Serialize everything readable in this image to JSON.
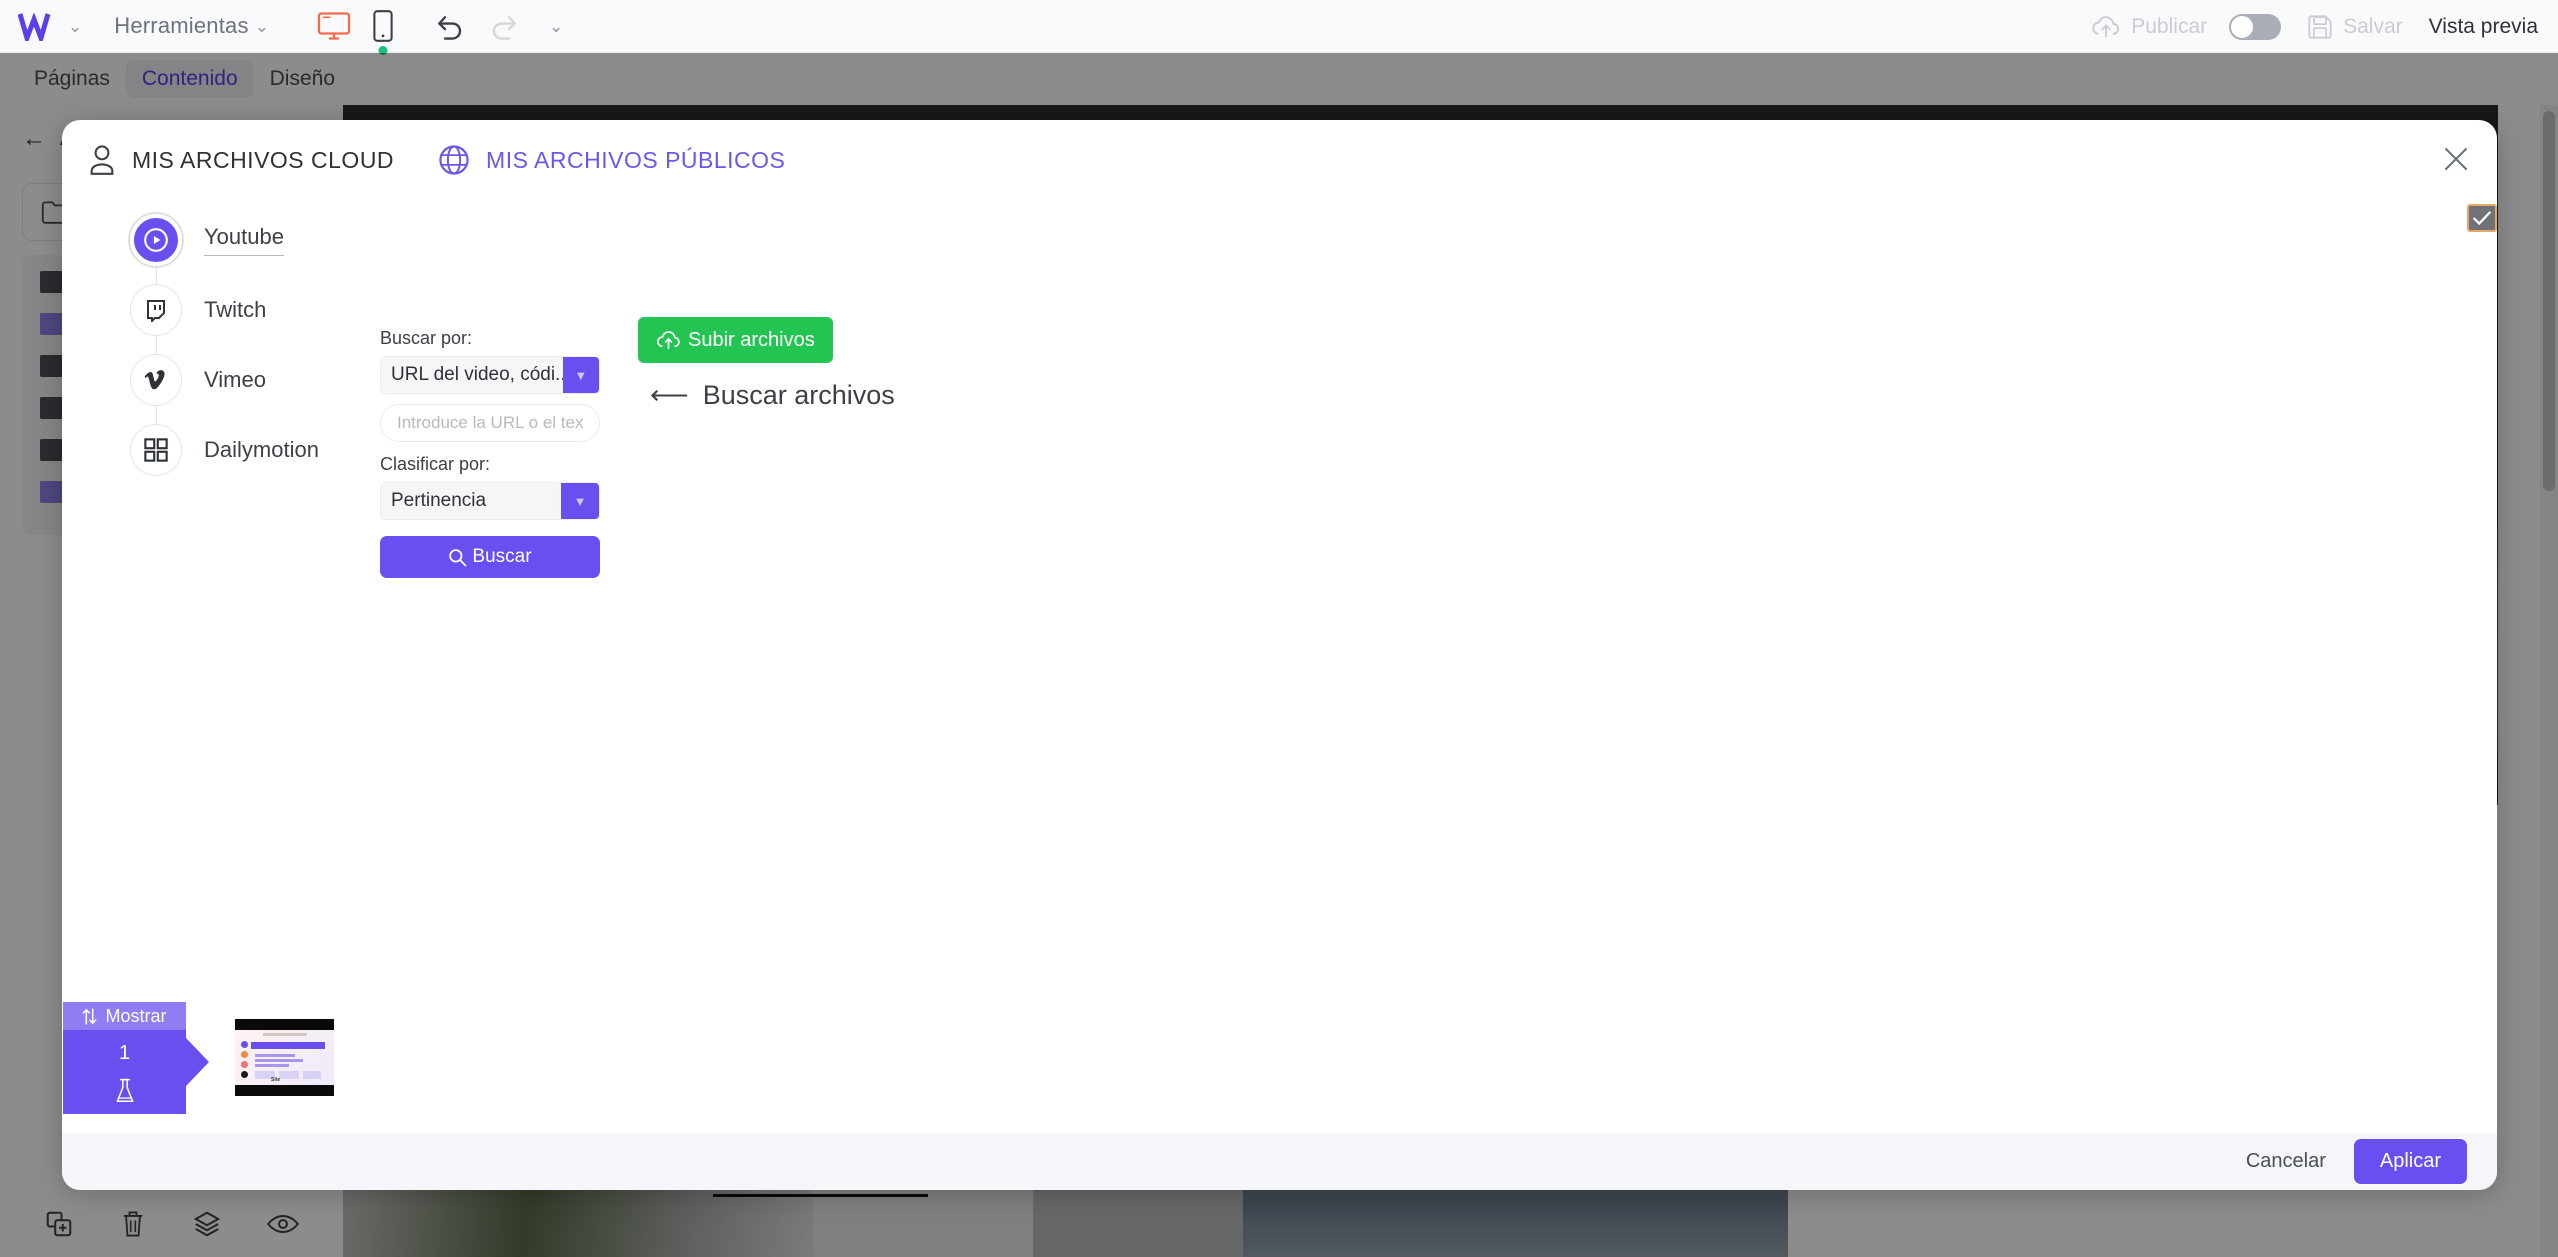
{
  "topbar": {
    "logo": "w-logo",
    "tools_label": "Herramientas",
    "publish_label": "Publicar",
    "save_label": "Salvar",
    "preview_label": "Vista previa",
    "desktop_icon": "desktop-icon",
    "mobile_icon": "mobile-icon",
    "undo_icon": "undo-icon",
    "redo_icon": "redo-icon",
    "more_icon": "chevron-down-icon"
  },
  "tabsbar": {
    "tabs": [
      {
        "label": "Páginas",
        "active": false
      },
      {
        "label": "Contenido",
        "active": true
      },
      {
        "label": "Diseño",
        "active": false
      }
    ]
  },
  "left_panel": {
    "back_label": "Atrás",
    "folder_icon": "folder-icon"
  },
  "bottom_toolbar": {
    "items": [
      {
        "icon": "duplicate-icon"
      },
      {
        "icon": "trash-icon"
      },
      {
        "icon": "layers-icon"
      },
      {
        "icon": "eye-icon"
      }
    ]
  },
  "canvas": {
    "watermark": "Site",
    "watermark_accent": "W"
  },
  "modal": {
    "tabs": [
      {
        "label": "MIS ARCHIVOS CLOUD",
        "icon": "user-icon",
        "active": true
      },
      {
        "label": "MIS ARCHIVOS PÚBLICOS",
        "icon": "globe-icon",
        "active": false
      }
    ],
    "close_icon": "close-icon",
    "selection_checkbox": {
      "icon": "check-icon",
      "checked": true
    },
    "platforms": [
      {
        "label": "Youtube",
        "icon": "youtube-icon",
        "active": true
      },
      {
        "label": "Twitch",
        "icon": "twitch-icon",
        "active": false
      },
      {
        "label": "Vimeo",
        "icon": "vimeo-icon",
        "active": false
      },
      {
        "label": "Dailymotion",
        "icon": "dailymotion-icon",
        "active": false
      }
    ],
    "form": {
      "search_by_label": "Buscar por:",
      "search_by_value": "URL del video, códi...",
      "query_placeholder": "Introduce la URL o el texto",
      "query_value": "",
      "sort_by_label": "Clasificar por:",
      "sort_by_value": "Pertinencia",
      "search_button_label": "Buscar",
      "search_button_icon": "magnifier-icon"
    },
    "content": {
      "upload_button_label": "Subir archivos",
      "upload_button_icon": "cloud-upload-icon",
      "back_link_label": "Buscar archivos",
      "back_link_icon": "arrow-left-icon"
    },
    "footer": {
      "cancel_label": "Cancelar",
      "apply_label": "Aplicar"
    }
  },
  "mostrar_widget": {
    "header_label": "Mostrar",
    "header_icon": "sort-arrows-icon",
    "count": "1",
    "bottom_icon": "flask-icon"
  },
  "colors": {
    "accent_purple": "#6a4ff0",
    "accent_purple_light": "#8f7df3",
    "green_upload": "#23c552",
    "text_dark": "#2e3238",
    "text_muted": "#6c7280",
    "mobile_status_green": "#18c27a",
    "desktop_icon_orange": "#f4694a"
  }
}
